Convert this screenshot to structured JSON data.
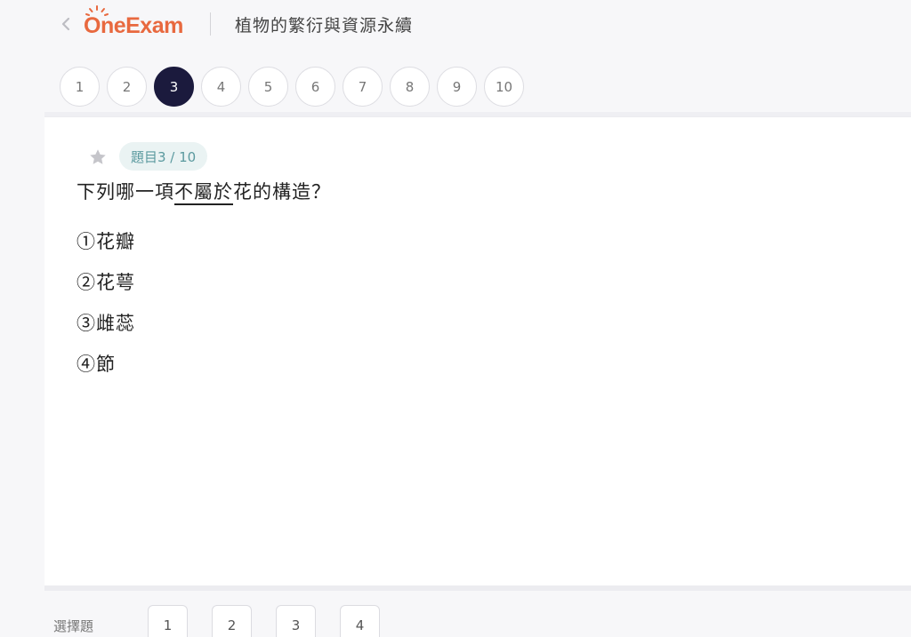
{
  "header": {
    "logo_text": "OneExam",
    "exam_title": "植物的繁衍與資源永續"
  },
  "question_nav": {
    "numbers": [
      "1",
      "2",
      "3",
      "4",
      "5",
      "6",
      "7",
      "8",
      "9",
      "10"
    ],
    "active": "3"
  },
  "question": {
    "badge": "題目3 / 10",
    "text_before": "下列哪一項",
    "text_underlined": "不屬於",
    "text_after": "花的構造？",
    "options": [
      "①花瓣",
      "②花萼",
      "③雌蕊",
      "④節"
    ]
  },
  "footer": {
    "type_label": "選擇題",
    "answers": [
      "1",
      "2",
      "3",
      "4"
    ]
  },
  "colors": {
    "accent": "#e8693f",
    "active_nav": "#1b1a3d",
    "badge_bg": "#eaf3f3",
    "badge_text": "#5b9a9f"
  }
}
